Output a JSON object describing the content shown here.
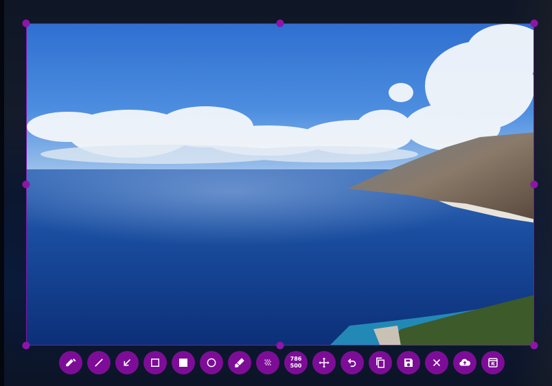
{
  "selection": {
    "width": "786",
    "height": "500"
  },
  "toolbar": {
    "tools": [
      {
        "name": "pencil-icon"
      },
      {
        "name": "line-icon"
      },
      {
        "name": "arrow-icon"
      },
      {
        "name": "rectangle-icon"
      },
      {
        "name": "filled-rectangle-icon"
      },
      {
        "name": "circle-icon"
      },
      {
        "name": "marker-icon"
      },
      {
        "name": "pixelate-icon"
      },
      {
        "name": "selection-size"
      },
      {
        "name": "move-icon"
      },
      {
        "name": "undo-icon"
      },
      {
        "name": "copy-icon"
      },
      {
        "name": "save-icon"
      },
      {
        "name": "close-icon"
      },
      {
        "name": "upload-icon"
      },
      {
        "name": "pin-icon"
      }
    ]
  },
  "colors": {
    "accent": "#7d0d97",
    "handle": "#8e15a8"
  }
}
